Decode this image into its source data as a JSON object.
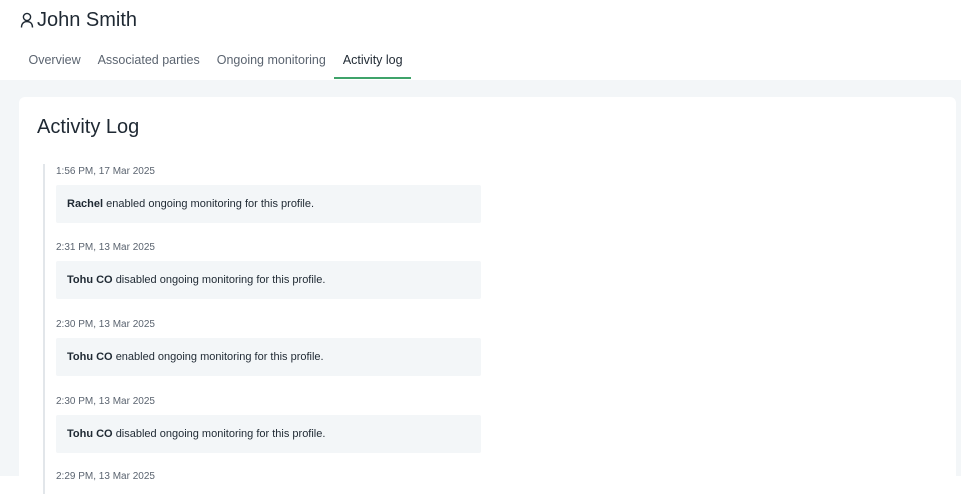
{
  "profile": {
    "name": "John Smith",
    "icon": "user-icon"
  },
  "tabs": [
    {
      "label": "Overview",
      "active": false
    },
    {
      "label": "Associated parties",
      "active": false
    },
    {
      "label": "Ongoing monitoring",
      "active": false
    },
    {
      "label": "Activity log",
      "active": true
    }
  ],
  "activity_log": {
    "title": "Activity Log",
    "entries": [
      {
        "time": "1:56 PM, 17 Mar 2025",
        "actor": "Rachel",
        "action": "enabled ongoing monitoring for this profile."
      },
      {
        "time": "2:31 PM, 13 Mar 2025",
        "actor": "Tohu CO",
        "action": "disabled ongoing monitoring for this profile."
      },
      {
        "time": "2:30 PM, 13 Mar 2025",
        "actor": "Tohu CO",
        "action": "enabled ongoing monitoring for this profile."
      },
      {
        "time": "2:30 PM, 13 Mar 2025",
        "actor": "Tohu CO",
        "action": "disabled ongoing monitoring for this profile."
      },
      {
        "time": "2:29 PM, 13 Mar 2025",
        "actor": "",
        "action": ""
      }
    ]
  },
  "colors": {
    "accent": "#3fa36a",
    "background": "#f3f6f8",
    "text": "#1f2933",
    "muted": "#5b6470"
  }
}
